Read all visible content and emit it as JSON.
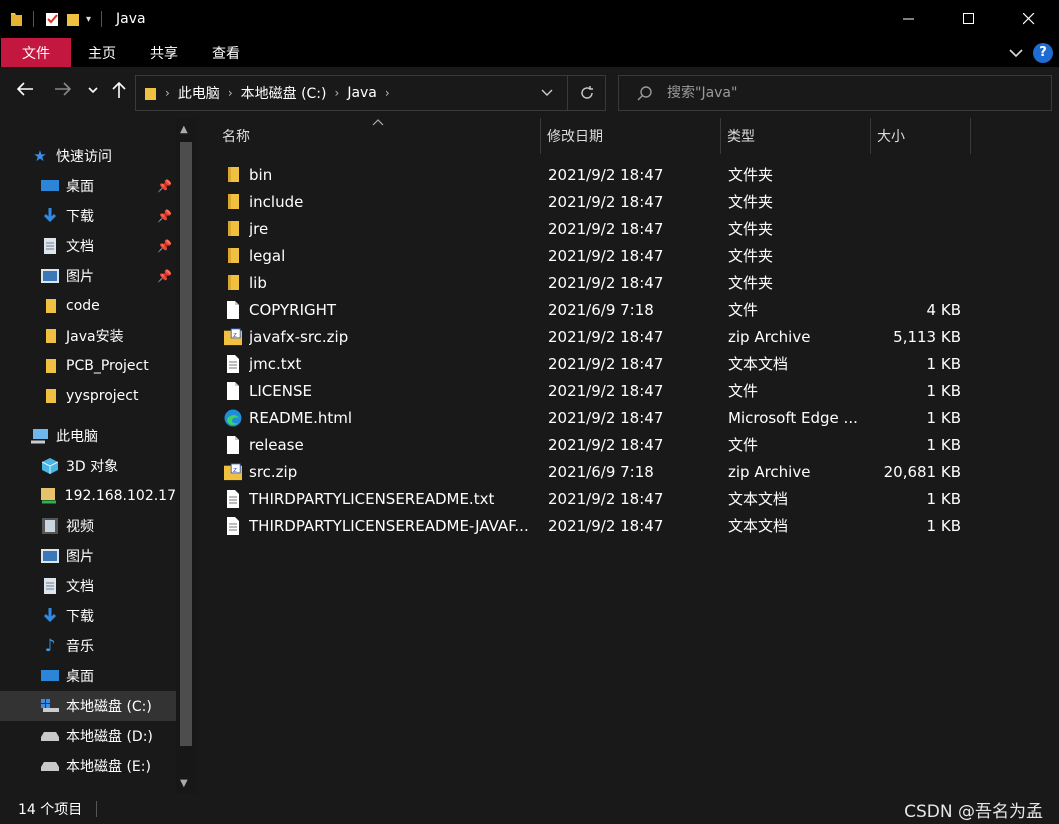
{
  "window": {
    "title": "Java"
  },
  "ribbon": {
    "tabs": [
      "文件",
      "主页",
      "共享",
      "查看"
    ],
    "help": "?"
  },
  "address": {
    "crumbs": [
      "此电脑",
      "本地磁盘 (C:)",
      "Java"
    ]
  },
  "search": {
    "placeholder": "搜索\"Java\""
  },
  "nav": {
    "quick_access": "快速访问",
    "items": [
      {
        "label": "桌面",
        "icon": "desktop-icon",
        "pinned": true
      },
      {
        "label": "下载",
        "icon": "download-icon",
        "pinned": true
      },
      {
        "label": "文档",
        "icon": "document-icon",
        "pinned": true
      },
      {
        "label": "图片",
        "icon": "pictures-icon",
        "pinned": true
      },
      {
        "label": "code",
        "icon": "folder-icon",
        "pinned": false
      },
      {
        "label": "Java安装",
        "icon": "folder-icon",
        "pinned": false
      },
      {
        "label": "PCB_Project",
        "icon": "folder-icon",
        "pinned": false
      },
      {
        "label": "yysproject",
        "icon": "folder-icon",
        "pinned": false
      }
    ],
    "this_pc": "此电脑",
    "pc_items": [
      {
        "label": "3D 对象",
        "icon": "3d-objects-icon"
      },
      {
        "label": "192.168.102.17",
        "icon": "network-drive-icon"
      },
      {
        "label": "视频",
        "icon": "video-icon"
      },
      {
        "label": "图片",
        "icon": "pictures-icon"
      },
      {
        "label": "文档",
        "icon": "document-icon"
      },
      {
        "label": "下载",
        "icon": "download-icon"
      },
      {
        "label": "音乐",
        "icon": "music-icon"
      },
      {
        "label": "桌面",
        "icon": "desktop-icon"
      },
      {
        "label": "本地磁盘 (C:)",
        "icon": "system-drive-icon",
        "selected": true
      },
      {
        "label": "本地磁盘 (D:)",
        "icon": "drive-icon"
      },
      {
        "label": "本地磁盘 (E:)",
        "icon": "drive-icon"
      }
    ]
  },
  "columns": {
    "name": "名称",
    "date": "修改日期",
    "type": "类型",
    "size": "大小"
  },
  "files": [
    {
      "name": "bin",
      "date": "2021/9/2 18:47",
      "type": "文件夹",
      "size": "",
      "icon": "folder"
    },
    {
      "name": "include",
      "date": "2021/9/2 18:47",
      "type": "文件夹",
      "size": "",
      "icon": "folder"
    },
    {
      "name": "jre",
      "date": "2021/9/2 18:47",
      "type": "文件夹",
      "size": "",
      "icon": "folder"
    },
    {
      "name": "legal",
      "date": "2021/9/2 18:47",
      "type": "文件夹",
      "size": "",
      "icon": "folder"
    },
    {
      "name": "lib",
      "date": "2021/9/2 18:47",
      "type": "文件夹",
      "size": "",
      "icon": "folder"
    },
    {
      "name": "COPYRIGHT",
      "date": "2021/6/9 7:18",
      "type": "文件",
      "size": "4 KB",
      "icon": "file"
    },
    {
      "name": "javafx-src.zip",
      "date": "2021/9/2 18:47",
      "type": "zip Archive",
      "size": "5,113 KB",
      "icon": "zip"
    },
    {
      "name": "jmc.txt",
      "date": "2021/9/2 18:47",
      "type": "文本文档",
      "size": "1 KB",
      "icon": "text"
    },
    {
      "name": "LICENSE",
      "date": "2021/9/2 18:47",
      "type": "文件",
      "size": "1 KB",
      "icon": "file"
    },
    {
      "name": "README.html",
      "date": "2021/9/2 18:47",
      "type": "Microsoft Edge ...",
      "size": "1 KB",
      "icon": "edge"
    },
    {
      "name": "release",
      "date": "2021/9/2 18:47",
      "type": "文件",
      "size": "1 KB",
      "icon": "file"
    },
    {
      "name": "src.zip",
      "date": "2021/6/9 7:18",
      "type": "zip Archive",
      "size": "20,681 KB",
      "icon": "zip"
    },
    {
      "name": "THIRDPARTYLICENSEREADME.txt",
      "date": "2021/9/2 18:47",
      "type": "文本文档",
      "size": "1 KB",
      "icon": "text"
    },
    {
      "name": "THIRDPARTYLICENSEREADME-JAVAF...",
      "date": "2021/9/2 18:47",
      "type": "文本文档",
      "size": "1 KB",
      "icon": "text"
    }
  ],
  "status": {
    "count": "14 个项目",
    "watermark": "CSDN @吾名为孟"
  },
  "colors": {
    "background": "#191919",
    "titlebar": "#000000",
    "file_tab": "#c4173f",
    "folder": "#f0c040",
    "accent_blue": "#3c8ee8"
  }
}
